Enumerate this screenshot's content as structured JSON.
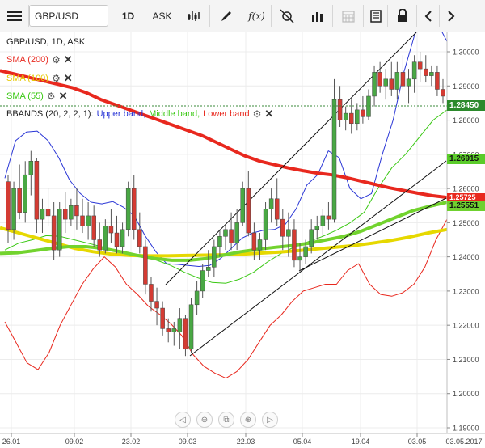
{
  "toolbar": {
    "symbol": "GBP/USD",
    "timeframe": "1D",
    "price_type": "ASK",
    "fx_label": "f(x)"
  },
  "chart_header": "GBP/USD, 1D, ASK",
  "indicators": [
    {
      "label": "SMA (200)",
      "color": "#e8281e"
    },
    {
      "label": "SMA (100)",
      "color": "#e6c800"
    },
    {
      "label": "SMA (55)",
      "color": "#39c812"
    }
  ],
  "bbands": {
    "label": "BBANDS (20, 2, 2, 1):",
    "upper": "Upper band,",
    "middle": "Middle band,",
    "lower": "Lower band",
    "upper_color": "#2a36d6",
    "middle_color": "#39c812",
    "lower_color": "#e8281e"
  },
  "colors": {
    "bull": "#49a844",
    "bear": "#d43b33",
    "sma200": "#e8281e",
    "sma100": "#e6d800",
    "sma55": "#72d32e",
    "upper": "#2a36d6",
    "middle": "#39c812",
    "lower": "#e8281e"
  },
  "price_tags": {
    "current": "1.28450",
    "sma55": "1.26915",
    "sma200": "1.25725",
    "sma100": "1.25551"
  },
  "chart_data": {
    "type": "candlestick",
    "x_ticks": [
      "26.01",
      "09.02",
      "23.02",
      "09.03",
      "22.03",
      "05.04",
      "19.04",
      "03.05",
      "03.05.2017"
    ],
    "y_ticks": [
      "1.30000",
      "1.29000",
      "1.28000",
      "1.27000",
      "1.26000",
      "1.25000",
      "1.24000",
      "1.23000",
      "1.22000",
      "1.21000",
      "1.20000",
      "1.19000"
    ],
    "ylim": [
      1.188,
      1.308
    ],
    "candles": [
      [
        1.262,
        1.264,
        1.244,
        1.248
      ],
      [
        1.248,
        1.262,
        1.245,
        1.26
      ],
      [
        1.26,
        1.267,
        1.251,
        1.253
      ],
      [
        1.253,
        1.268,
        1.25,
        1.264
      ],
      [
        1.264,
        1.271,
        1.258,
        1.268
      ],
      [
        1.268,
        1.269,
        1.247,
        1.251
      ],
      [
        1.251,
        1.257,
        1.247,
        1.254
      ],
      [
        1.254,
        1.26,
        1.249,
        1.252
      ],
      [
        1.252,
        1.256,
        1.239,
        1.242
      ],
      [
        1.242,
        1.256,
        1.24,
        1.254
      ],
      [
        1.254,
        1.259,
        1.247,
        1.251
      ],
      [
        1.251,
        1.257,
        1.249,
        1.255
      ],
      [
        1.255,
        1.26,
        1.248,
        1.252
      ],
      [
        1.252,
        1.257,
        1.247,
        1.249
      ],
      [
        1.249,
        1.256,
        1.245,
        1.252
      ],
      [
        1.252,
        1.255,
        1.243,
        1.245
      ],
      [
        1.245,
        1.25,
        1.24,
        1.242
      ],
      [
        1.242,
        1.251,
        1.241,
        1.249
      ],
      [
        1.249,
        1.254,
        1.244,
        1.247
      ],
      [
        1.247,
        1.252,
        1.241,
        1.243
      ],
      [
        1.243,
        1.25,
        1.241,
        1.248
      ],
      [
        1.248,
        1.262,
        1.246,
        1.26
      ],
      [
        1.26,
        1.264,
        1.245,
        1.248
      ],
      [
        1.248,
        1.253,
        1.241,
        1.243
      ],
      [
        1.243,
        1.245,
        1.229,
        1.232
      ],
      [
        1.232,
        1.234,
        1.224,
        1.227
      ],
      [
        1.227,
        1.231,
        1.22,
        1.225
      ],
      [
        1.225,
        1.227,
        1.217,
        1.219
      ],
      [
        1.219,
        1.222,
        1.215,
        1.218
      ],
      [
        1.218,
        1.221,
        1.214,
        1.219
      ],
      [
        1.218,
        1.225,
        1.213,
        1.222
      ],
      [
        1.222,
        1.223,
        1.211,
        1.213
      ],
      [
        1.213,
        1.228,
        1.212,
        1.226
      ],
      [
        1.226,
        1.233,
        1.223,
        1.23
      ],
      [
        1.23,
        1.238,
        1.228,
        1.236
      ],
      [
        1.236,
        1.242,
        1.234,
        1.237
      ],
      [
        1.237,
        1.245,
        1.234,
        1.243
      ],
      [
        1.243,
        1.248,
        1.24,
        1.246
      ],
      [
        1.246,
        1.249,
        1.242,
        1.248
      ],
      [
        1.248,
        1.253,
        1.242,
        1.244
      ],
      [
        1.244,
        1.254,
        1.242,
        1.25
      ],
      [
        1.25,
        1.262,
        1.249,
        1.26
      ],
      [
        1.26,
        1.265,
        1.246,
        1.247
      ],
      [
        1.247,
        1.25,
        1.239,
        1.242
      ],
      [
        1.242,
        1.247,
        1.239,
        1.245
      ],
      [
        1.245,
        1.256,
        1.242,
        1.254
      ],
      [
        1.254,
        1.26,
        1.25,
        1.257
      ],
      [
        1.257,
        1.263,
        1.249,
        1.251
      ],
      [
        1.251,
        1.254,
        1.242,
        1.246
      ],
      [
        1.246,
        1.253,
        1.24,
        1.248
      ],
      [
        1.248,
        1.251,
        1.237,
        1.239
      ],
      [
        1.239,
        1.244,
        1.236,
        1.24
      ],
      [
        1.24,
        1.245,
        1.238,
        1.243
      ],
      [
        1.243,
        1.251,
        1.241,
        1.248
      ],
      [
        1.248,
        1.252,
        1.245,
        1.249
      ],
      [
        1.249,
        1.254,
        1.246,
        1.252
      ],
      [
        1.252,
        1.256,
        1.248,
        1.251
      ],
      [
        1.251,
        1.292,
        1.25,
        1.286
      ],
      [
        1.286,
        1.29,
        1.278,
        1.28
      ],
      [
        1.28,
        1.284,
        1.277,
        1.282
      ],
      [
        1.282,
        1.286,
        1.276,
        1.279
      ],
      [
        1.279,
        1.285,
        1.277,
        1.283
      ],
      [
        1.283,
        1.287,
        1.279,
        1.281
      ],
      [
        1.281,
        1.289,
        1.28,
        1.287
      ],
      [
        1.287,
        1.296,
        1.284,
        1.294
      ],
      [
        1.294,
        1.297,
        1.288,
        1.29
      ],
      [
        1.29,
        1.295,
        1.286,
        1.292
      ],
      [
        1.292,
        1.297,
        1.287,
        1.289
      ],
      [
        1.289,
        1.297,
        1.286,
        1.294
      ],
      [
        1.294,
        1.299,
        1.289,
        1.29
      ],
      [
        1.29,
        1.295,
        1.285,
        1.292
      ],
      [
        1.292,
        1.299,
        1.288,
        1.297
      ],
      [
        1.297,
        1.3,
        1.291,
        1.295
      ],
      [
        1.295,
        1.299,
        1.291,
        1.293
      ],
      [
        1.293,
        1.296,
        1.29,
        1.294
      ],
      [
        1.294,
        1.296,
        1.287,
        1.289
      ],
      [
        1.289,
        1.292,
        1.285,
        1.287
      ]
    ],
    "sma200": [
      1.2945,
      1.2935,
      1.2925,
      1.2915,
      1.2905,
      1.2895,
      1.288,
      1.286,
      1.2845,
      1.283,
      1.2815,
      1.28,
      1.2785,
      1.277,
      1.2755,
      1.2735,
      1.2715,
      1.2695,
      1.268,
      1.267,
      1.266,
      1.2652,
      1.2645,
      1.264,
      1.2632,
      1.2622,
      1.2612,
      1.2602,
      1.2594,
      1.2586,
      1.2579,
      1.2574
    ],
    "sma100": [
      1.2485,
      1.247,
      1.2455,
      1.244,
      1.2425,
      1.2415,
      1.2408,
      1.2404,
      1.2403,
      1.2403,
      1.2404,
      1.2405,
      1.2406,
      1.2408,
      1.2411,
      1.2414,
      1.2418,
      1.2423,
      1.2428,
      1.2433,
      1.244,
      1.2448,
      1.2458,
      1.247,
      1.248
    ],
    "sma55": [
      1.241,
      1.2412,
      1.2418,
      1.2425,
      1.243,
      1.243,
      1.2425,
      1.2415,
      1.2404,
      1.2395,
      1.239,
      1.239,
      1.2395,
      1.2405,
      1.2415,
      1.2422,
      1.2428,
      1.2433,
      1.244,
      1.245,
      1.246,
      1.2475,
      1.2495,
      1.2515,
      1.2535,
      1.2548,
      1.256
    ],
    "upper": [
      1.263,
      1.274,
      1.2765,
      1.2768,
      1.274,
      1.269,
      1.2625,
      1.2585,
      1.256,
      1.2555,
      1.2562,
      1.2545,
      1.252,
      1.2462,
      1.2415,
      1.238,
      1.2378,
      1.2375,
      1.2372,
      1.2375,
      1.2395,
      1.2425,
      1.2455,
      1.247,
      1.2478,
      1.248,
      1.2495,
      1.254,
      1.261,
      1.264,
      1.271,
      1.269,
      1.26,
      1.257,
      1.2585,
      1.27,
      1.28,
      1.294,
      1.305,
      1.3105,
      1.309,
      1.303
    ],
    "middle": [
      1.242,
      1.244,
      1.245,
      1.2462,
      1.246,
      1.245,
      1.244,
      1.243,
      1.242,
      1.241,
      1.24,
      1.239,
      1.2375,
      1.2355,
      1.2338,
      1.2325,
      1.2323,
      1.2335,
      1.2355,
      1.2385,
      1.241,
      1.243,
      1.2445,
      1.246,
      1.2478,
      1.25,
      1.253,
      1.26,
      1.266,
      1.27,
      1.275,
      1.28,
      1.283
    ],
    "lower": [
      1.221,
      1.215,
      1.209,
      1.207,
      1.212,
      1.22,
      1.226,
      1.232,
      1.2365,
      1.24,
      1.237,
      1.232,
      1.229,
      1.2255,
      1.2232,
      1.2205,
      1.217,
      1.2115,
      1.208,
      1.206,
      1.2045,
      1.2065,
      1.21,
      1.215,
      1.22,
      1.223,
      1.227,
      1.23,
      1.231,
      1.232,
      1.232,
      1.236,
      1.238,
      1.232,
      1.229,
      1.2285,
      1.2295,
      1.232,
      1.237,
      1.245,
      1.251
    ]
  }
}
